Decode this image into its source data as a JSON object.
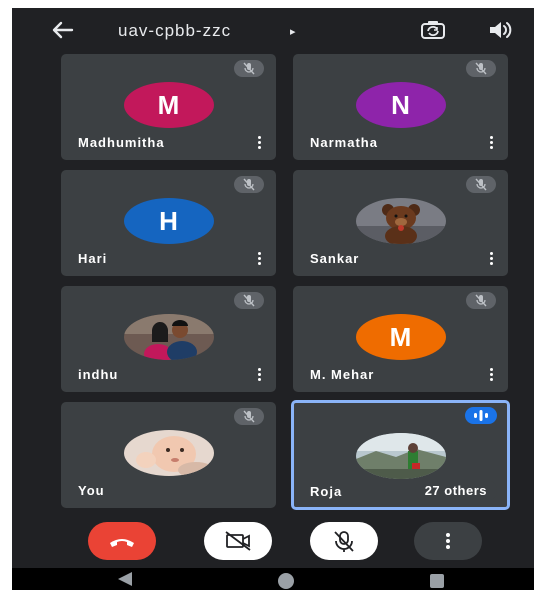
{
  "header": {
    "meeting_code": "uav-cpbb-zzc",
    "caret": "▸",
    "icons": [
      "arrow-left",
      "switch-camera",
      "speaker"
    ]
  },
  "participants": [
    {
      "name": "Madhumitha",
      "initial": "M",
      "avatar_color": "#c2185b"
    },
    {
      "name": "Narmatha",
      "initial": "N",
      "avatar_color": "#8e24aa"
    },
    {
      "name": "Hari",
      "initial": "H",
      "avatar_color": "#1565c0"
    },
    {
      "name": "Sankar",
      "photo": "teddy-bear"
    },
    {
      "name": "indhu",
      "photo": "couple"
    },
    {
      "name": "M. Mehar",
      "initial": "M",
      "avatar_color": "#ef6c00"
    },
    {
      "name": "You",
      "photo": "baby"
    },
    {
      "name": "Roja",
      "photo": "scenery",
      "others_label": "27 others",
      "speaking": true
    }
  ],
  "controls": {
    "colors": {
      "end_call": "#ea4335",
      "toggle_on": "#ffffff",
      "more": "#3c4043"
    },
    "icons": [
      "end-call",
      "camera-off",
      "mic-off",
      "more-vert"
    ]
  },
  "colors": {
    "background": "#202124",
    "tile": "#3c4043",
    "accent": "#8ab4f8"
  }
}
